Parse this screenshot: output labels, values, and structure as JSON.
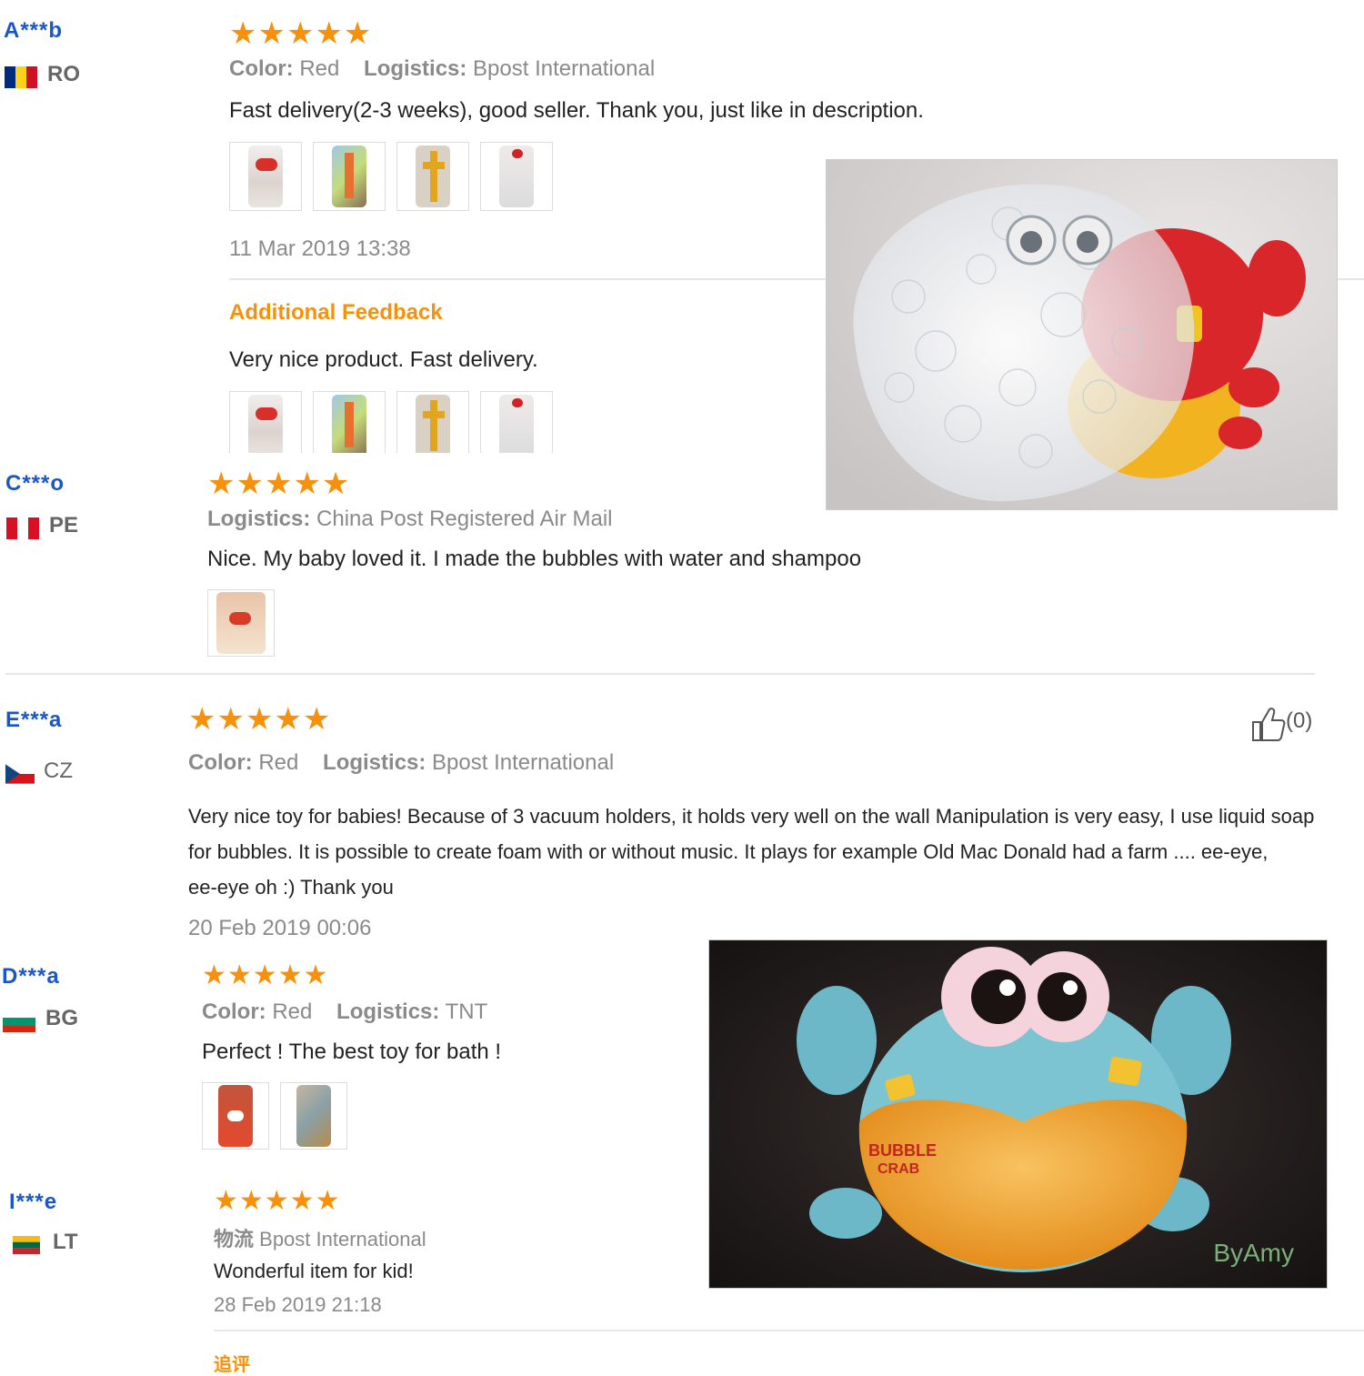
{
  "reviews": [
    {
      "user": "A***b",
      "country": "RO",
      "flag_colors": [
        "#002b7f",
        "#fcd116",
        "#ce1126"
      ],
      "stars": "★★★★★",
      "color_label": "Color:",
      "color_value": "Red",
      "logistics_label": "Logistics:",
      "logistics_value": "Bpost International",
      "text": "Fast delivery(2-3 weeks), good seller. Thank you, just like in description.",
      "date": "11 Mar 2019 13:38",
      "additional_title": "Additional Feedback",
      "additional_text": "Very nice product. Fast delivery."
    },
    {
      "user": "C***o",
      "country": "PE",
      "flag_colors": [
        "#d91023",
        "#ffffff",
        "#d91023"
      ],
      "stars": "★★★★★",
      "logistics_label": "Logistics:",
      "logistics_value": "China Post Registered Air Mail",
      "text": "Nice. My baby loved it. I made the bubbles with water and shampoo"
    },
    {
      "user": "E***a",
      "country": "CZ",
      "stars": "★★★★★",
      "likes": "(0)",
      "color_label": "Color:",
      "color_value": "Red",
      "logistics_label": "Logistics:",
      "logistics_value": "Bpost International",
      "text_lines": [
        "Very nice toy for babies! Because of 3 vacuum holders, it holds very well on the wall Manipulation is very easy, I use liquid soap",
        "for bubbles. It is possible to create foam with or without music. It plays for example Old Mac Donald had a farm .... ee-eye,",
        "ee-eye oh :) Thank you"
      ],
      "date": "20 Feb 2019 00:06"
    },
    {
      "user": "D***a",
      "country": "BG",
      "flag_colors": [
        "#ffffff",
        "#00966e",
        "#d62612"
      ],
      "stars": "★★★★★",
      "color_label": "Color:",
      "color_value": "Red",
      "logistics_label": "Logistics:",
      "logistics_value": "TNT",
      "text": "Perfect ! The best toy for bath !"
    },
    {
      "user": "I***e",
      "country": "LT",
      "flag_colors": [
        "#fdb913",
        "#006a44",
        "#c1272d"
      ],
      "stars": "★★★★★",
      "logistics_label": "物流",
      "logistics_value": "Bpost International",
      "text": "Wonderful item for kid!",
      "date": "28 Feb 2019 21:18",
      "additional_title": "追评"
    }
  ],
  "photos": {
    "crab_bubbles": {
      "accent": "#d8262b"
    },
    "blue_crab": {
      "brand_line1": "BUBBLE",
      "brand_line2": "CRAB",
      "watermark": "ByAmy"
    }
  }
}
